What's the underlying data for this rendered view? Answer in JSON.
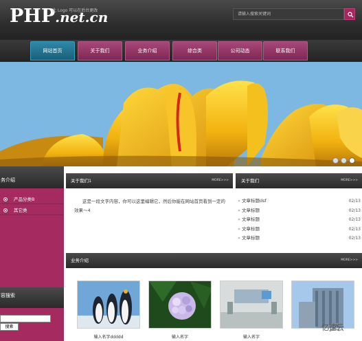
{
  "header": {
    "logo_main": "PHP",
    "logo_net": ".net.cn",
    "logo_sub": "此 Logo 可以在后台更改",
    "search_placeholder": "请输入搜索关键词"
  },
  "nav": {
    "items": [
      "网站首页",
      "关于我们",
      "业务介绍",
      "综合类",
      "公司动态",
      "联系我们"
    ],
    "active": "网站首页"
  },
  "banner": {
    "slides": 3,
    "active_slide": 3
  },
  "left": {
    "section1_title": "务介绍",
    "items": [
      "产品分类B",
      "其它类"
    ],
    "section2_title": "容搜索",
    "search_button": "搜索"
  },
  "about": {
    "title": "关于我们1",
    "more": "MORE>>>",
    "text": "这是一段文字内容，你可以这里编辑它，然后你能在网站首页看到一定的效果～4"
  },
  "news": {
    "title": "关于我们",
    "more": "MORE>>>",
    "items": [
      {
        "title": "文章标题dsf",
        "date": "02/13"
      },
      {
        "title": "文章标题",
        "date": "02/13"
      },
      {
        "title": "文章标题",
        "date": "02/13"
      },
      {
        "title": "文章标题",
        "date": "02/13"
      },
      {
        "title": "文章标题",
        "date": "02/13"
      }
    ]
  },
  "business": {
    "title": "业务介绍",
    "more": "MORE>>>",
    "products": [
      {
        "caption": "输入名字ddddd"
      },
      {
        "caption": "输入名字"
      },
      {
        "caption": "输入名字"
      },
      {
        "caption": ""
      }
    ]
  },
  "watermark": {
    "text": "亿速云"
  },
  "colors": {
    "accent": "#a42a5f",
    "nav_active": "#2e88a8",
    "header_dark": "#2d2d2d"
  }
}
